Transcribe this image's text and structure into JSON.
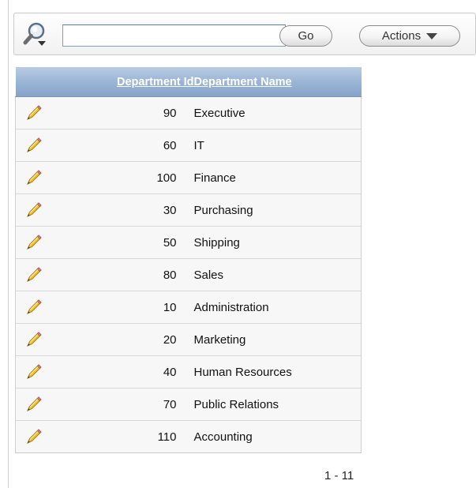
{
  "search": {
    "value": "",
    "placeholder": "",
    "go_label": "Go",
    "actions_label": "Actions"
  },
  "report": {
    "columns": [
      {
        "label": "Department Id"
      },
      {
        "label": "Department Name"
      }
    ],
    "rows": [
      {
        "id": "90",
        "name": "Executive"
      },
      {
        "id": "60",
        "name": "IT"
      },
      {
        "id": "100",
        "name": "Finance"
      },
      {
        "id": "30",
        "name": "Purchasing"
      },
      {
        "id": "50",
        "name": "Shipping"
      },
      {
        "id": "80",
        "name": "Sales"
      },
      {
        "id": "10",
        "name": "Administration"
      },
      {
        "id": "20",
        "name": "Marketing"
      },
      {
        "id": "40",
        "name": "Human Resources"
      },
      {
        "id": "70",
        "name": "Public Relations"
      },
      {
        "id": "110",
        "name": "Accounting"
      }
    ]
  },
  "pagination": {
    "range": "1 - 11"
  },
  "colors": {
    "header_bg": "#98b3d4",
    "header_text": "#ffffff",
    "row_bg": "#f7f7f7",
    "pencil": "#f2c230"
  },
  "icons": {
    "search": "magnifier-with-dropdown-icon",
    "edit": "pencil-icon",
    "actions_caret": "caret-down-icon"
  }
}
